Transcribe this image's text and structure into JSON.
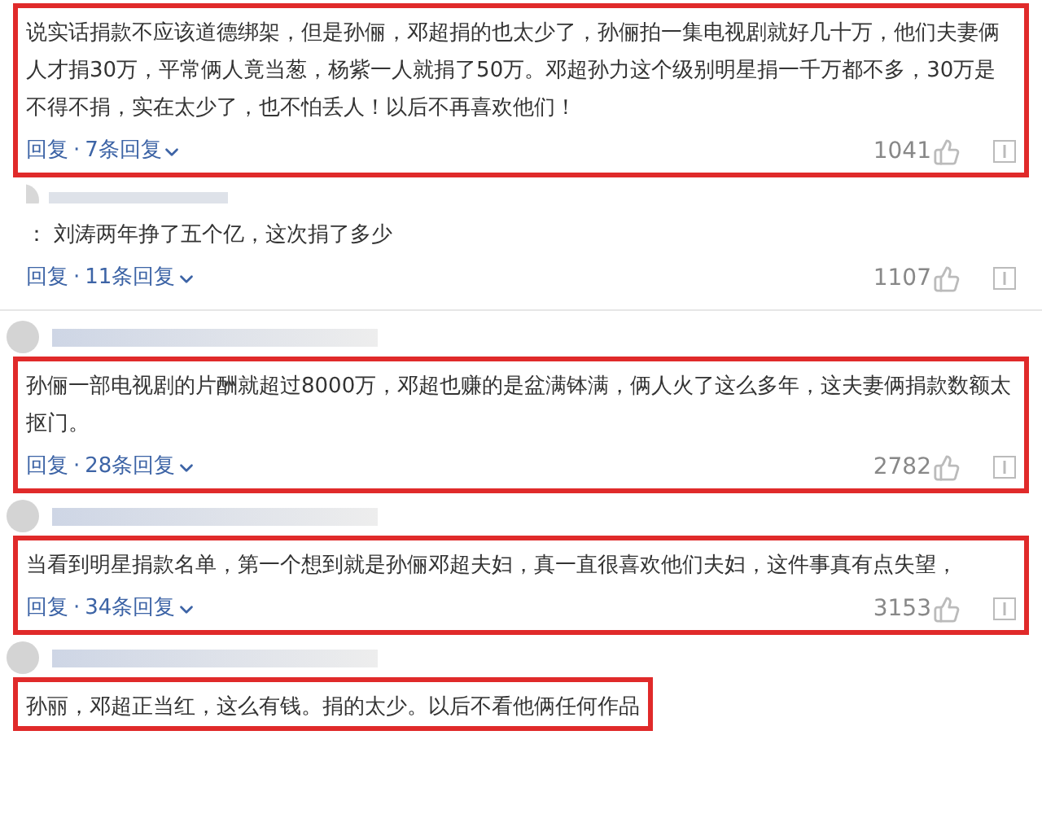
{
  "comments": [
    {
      "kind": "continued",
      "highlighted": true,
      "text": "说实话捐款不应该道德绑架，但是孙俪，邓超捐的也太少了，孙俪拍一集电视剧就好几十万，他们夫妻俩人才捐30万，平常俩人竟当葱，杨紫一人就捐了50万。邓超孙力这个级别明星捐一千万都不多，30万是不得不捐，实在太少了，也不怕丢人！以后不再喜欢他们！",
      "reply": "回复",
      "separator": "·",
      "replies": "7条回复",
      "likes": "1041"
    },
    {
      "kind": "cut",
      "highlighted": false,
      "text": "： 刘涛两年挣了五个亿，这次捐了多少",
      "reply": "回复",
      "separator": "·",
      "replies": "11条回复",
      "likes": "1107"
    },
    {
      "kind": "full",
      "highlighted": true,
      "text": "孙俪一部电视剧的片酬就超过8000万，邓超也赚的是盆满钵满，俩人火了这么多年，这夫妻俩捐款数额太抠门。",
      "reply": "回复",
      "separator": "·",
      "replies": "28条回复",
      "likes": "2782"
    },
    {
      "kind": "full",
      "highlighted": true,
      "text": "当看到明星捐款名单，第一个想到就是孙俪邓超夫妇，真一直很喜欢他们夫妇，这件事真有点失望，",
      "reply": "回复",
      "separator": "·",
      "replies": "34条回复",
      "likes": "3153"
    },
    {
      "kind": "full",
      "highlighted": true,
      "text": "孙丽，邓超正当红，这么有钱。捐的太少。以后不看他俩任何作品"
    }
  ]
}
